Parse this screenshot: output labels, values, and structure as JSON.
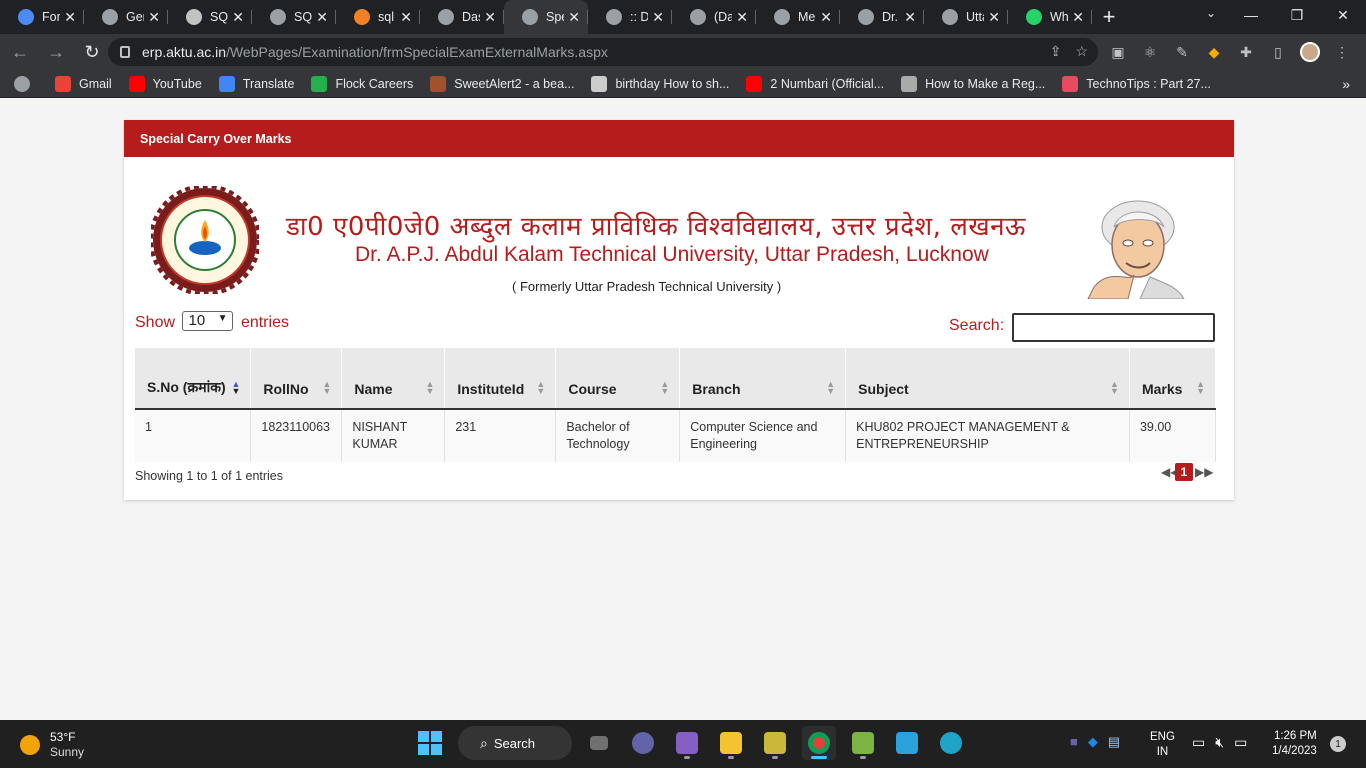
{
  "browser": {
    "tabs": [
      {
        "label": "Fon",
        "color": "#4c8bf5",
        "active": false
      },
      {
        "label": "Ger",
        "color": "#9aa0a6",
        "active": false
      },
      {
        "label": "SQL",
        "color": "#c2c2c2",
        "active": false
      },
      {
        "label": "SQL",
        "color": "#9aa0a6",
        "active": false
      },
      {
        "label": "sql",
        "color": "#f48024",
        "active": false
      },
      {
        "label": "Das",
        "color": "#9aa0a6",
        "active": false
      },
      {
        "label": "Spe",
        "color": "#9aa0a6",
        "active": true
      },
      {
        "label": ":: Dr",
        "color": "#9aa0a6",
        "active": false
      },
      {
        "label": "(Dat",
        "color": "#9aa0a6",
        "active": false
      },
      {
        "label": "Mer",
        "color": "#9aa0a6",
        "active": false
      },
      {
        "label": "Dr.",
        "color": "#9aa0a6",
        "active": false
      },
      {
        "label": "Utta",
        "color": "#9aa0a6",
        "active": false
      },
      {
        "label": "Wh",
        "color": "#25d366",
        "active": false
      }
    ],
    "new_tab": "+",
    "url_host": "erp.aktu.ac.in",
    "url_path": "/WebPages/Examination/frmSpecialExamExternalMarks.aspx",
    "bookmarks": [
      {
        "label": "Gmail",
        "color": "#ea4335"
      },
      {
        "label": "YouTube",
        "color": "#ff0000"
      },
      {
        "label": "Translate",
        "color": "#4285f4"
      },
      {
        "label": "Flock Careers",
        "color": "#22b14c"
      },
      {
        "label": "SweetAlert2 - a bea...",
        "color": "#a0522d"
      },
      {
        "label": "birthday How to sh...",
        "color": "#cccccc"
      },
      {
        "label": "2 Numbari (Official...",
        "color": "#ff0000"
      },
      {
        "label": "How to Make a Reg...",
        "color": "#aaaaaa"
      },
      {
        "label": "TechnoTips : Part 27...",
        "color": "#e84a5f"
      }
    ]
  },
  "page": {
    "card_title": "Special Carry Over Marks",
    "university_hindi": "डा0 ए0पी0जे0 अब्दुल कलाम प्राविधिक विश्वविद्यालय, उत्तर प्रदेश, लखनऊ",
    "university_english": "Dr. A.P.J. Abdul Kalam Technical University, Uttar Pradesh, Lucknow",
    "formerly": "( Formerly Uttar Pradesh Technical University )",
    "show_label": "Show",
    "entries_label": "entries",
    "page_length": "10",
    "search_label": "Search:",
    "search_value": "",
    "table": {
      "columns": [
        "S.No (क्रमांक)",
        "RollNo",
        "Name",
        "InstituteId",
        "Course",
        "Branch",
        "Subject",
        "Marks"
      ],
      "rows": [
        [
          "1",
          "1823110063",
          "NISHANT KUMAR",
          "231",
          "Bachelor of Technology",
          "Computer Science and Engineering",
          "KHU802 PROJECT MANAGEMENT & ENTREPRENEURSHIP",
          "39.00"
        ]
      ]
    },
    "info": "Showing 1 to 1 of 1 entries",
    "current_page": "1"
  },
  "taskbar": {
    "temperature": "53°F",
    "condition": "Sunny",
    "search_label": "Search",
    "language": "ENG",
    "region": "IN",
    "time": "1:26 PM",
    "date": "1/4/2023",
    "notifications": "1"
  },
  "colors": {
    "accent": "#b71c1c",
    "chrome_dark": "#202124",
    "chrome_toolbar": "#35363a"
  }
}
